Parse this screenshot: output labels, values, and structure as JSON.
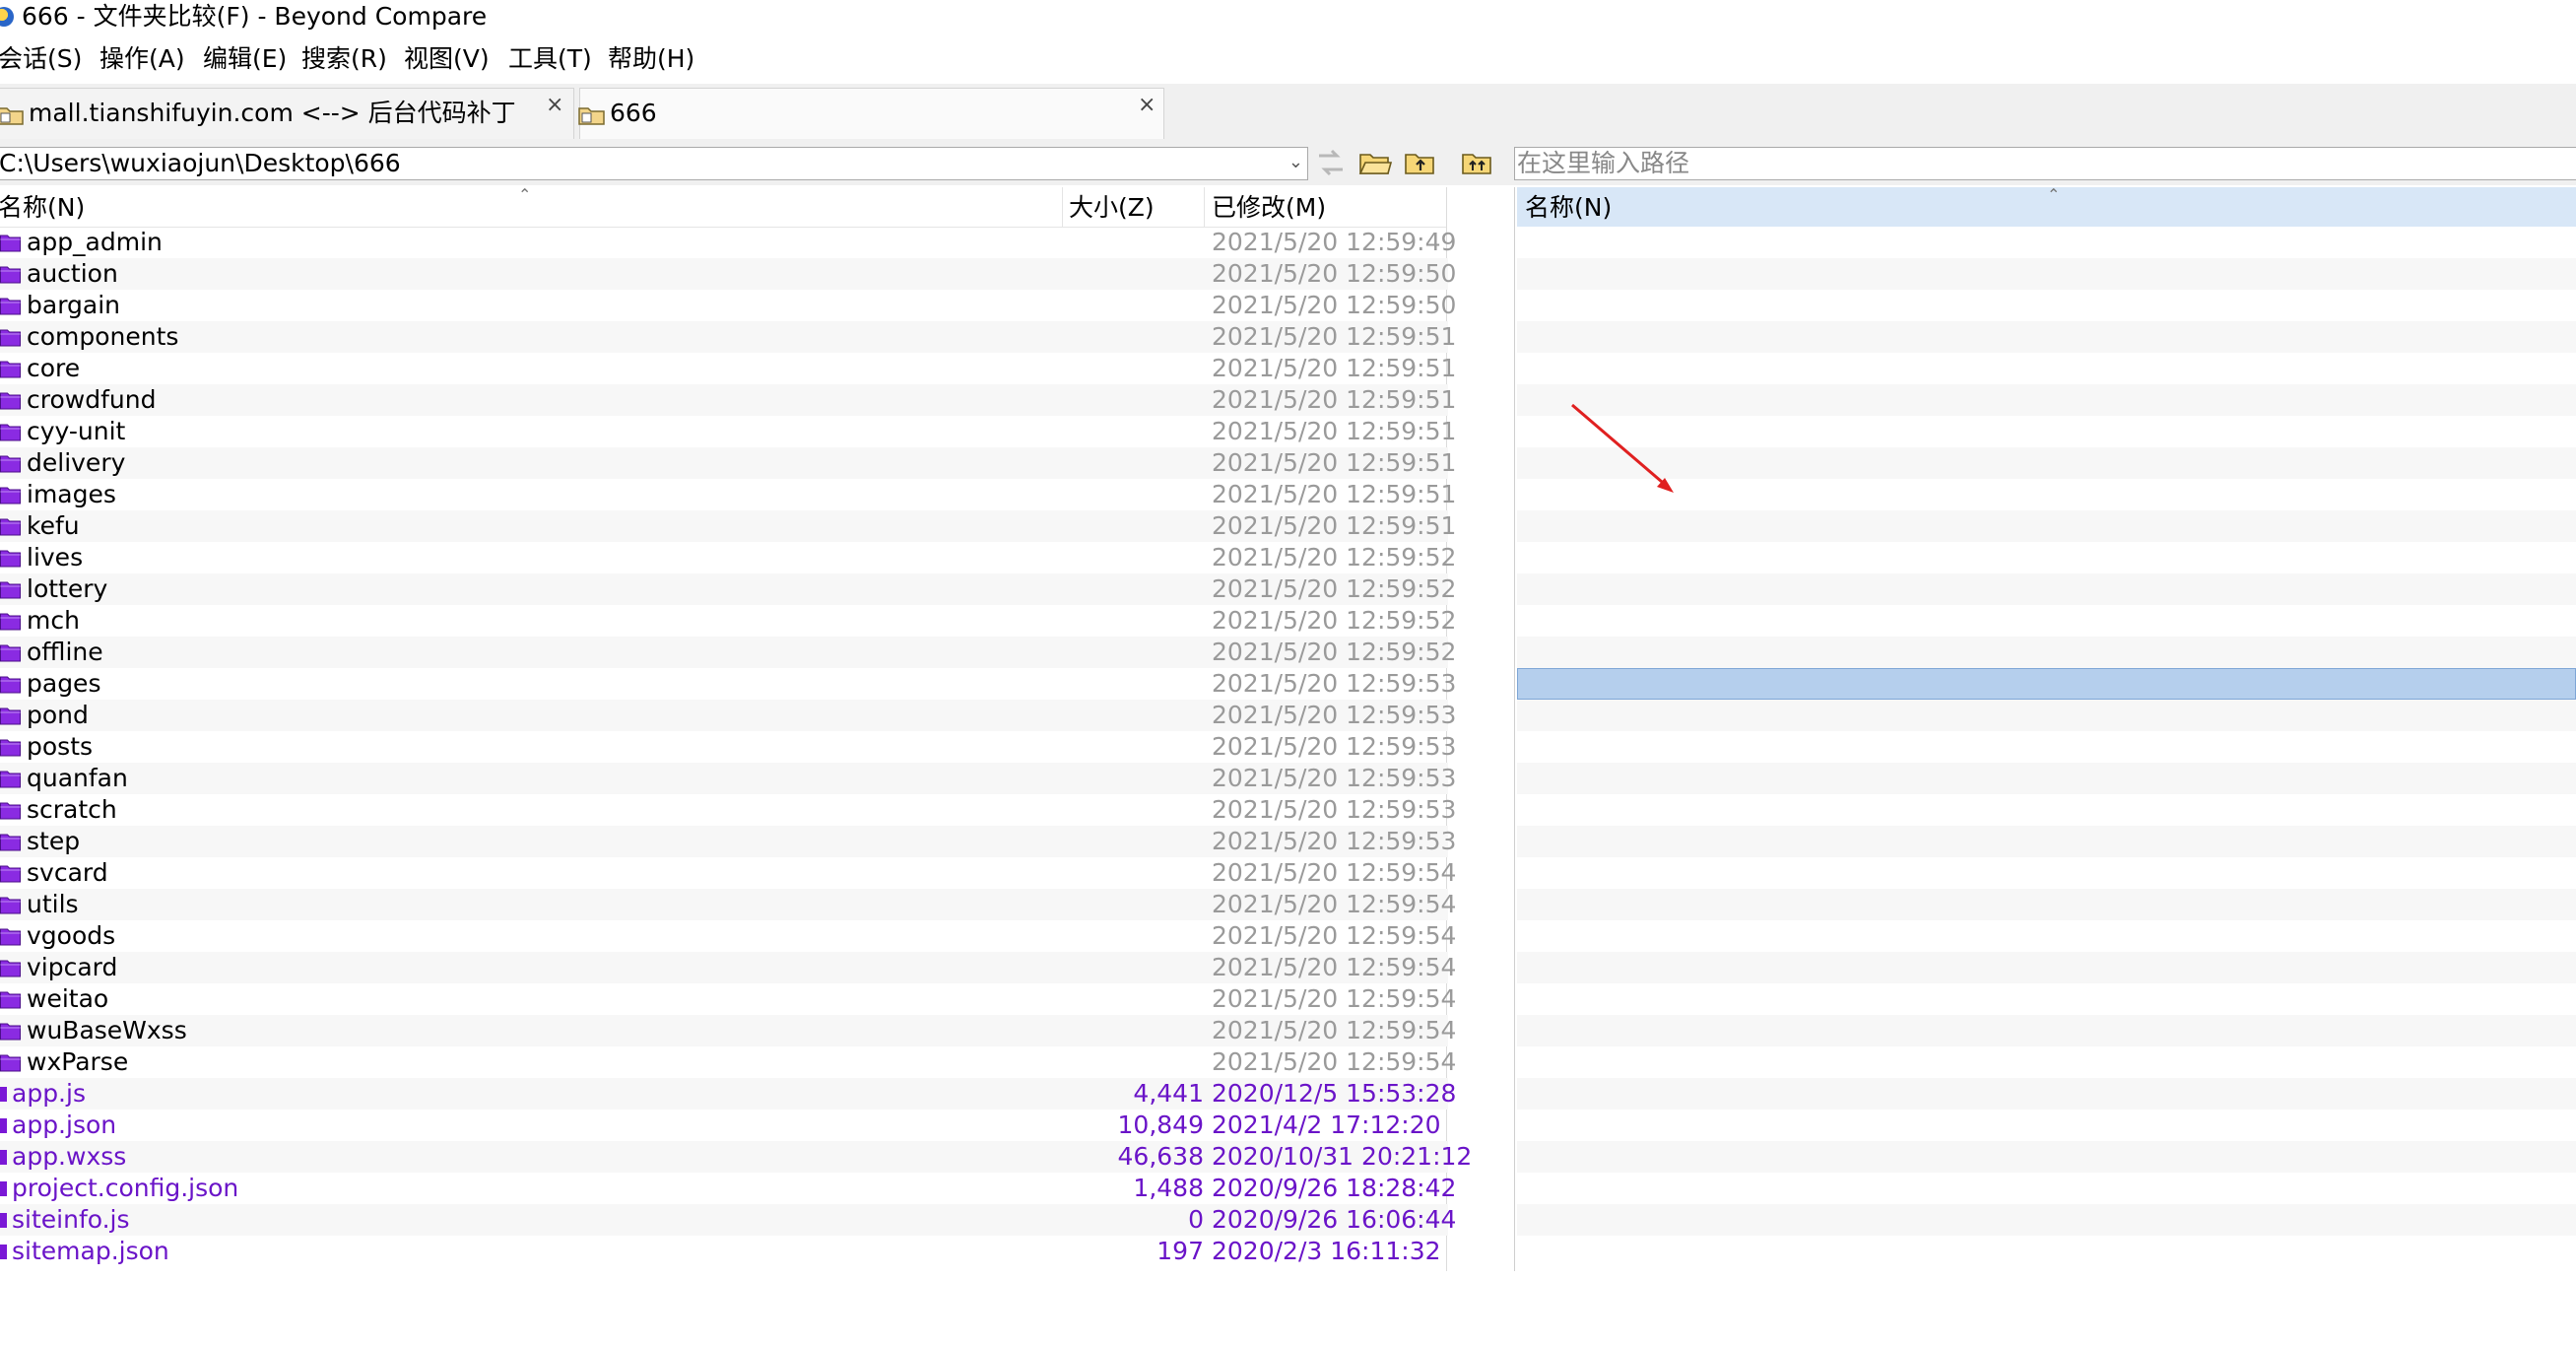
{
  "title_bar": {
    "title": "666 - 文件夹比较(F) - Beyond Compare"
  },
  "menu": {
    "items": [
      "会话(S)",
      "操作(A)",
      "编辑(E)",
      "搜索(R)",
      "视图(V)",
      "工具(T)",
      "帮助(H)"
    ]
  },
  "tabs": [
    {
      "label": "mall.tianshifuyin.com <--> 后台代码补丁",
      "close": "×"
    },
    {
      "label": "666",
      "close": "×"
    }
  ],
  "path_bar": {
    "left_path": "C:\\Users\\wuxiaojun\\Desktop\\666",
    "right_placeholder": "在这里输入路径"
  },
  "left_columns": {
    "name": "名称(N)",
    "size": "大小(Z)",
    "modified": "已修改(M)"
  },
  "right_columns": {
    "name": "名称(N)"
  },
  "folders": [
    {
      "name": "app_admin",
      "modified": "2021/5/20 12:59:49"
    },
    {
      "name": "auction",
      "modified": "2021/5/20 12:59:50"
    },
    {
      "name": "bargain",
      "modified": "2021/5/20 12:59:50"
    },
    {
      "name": "components",
      "modified": "2021/5/20 12:59:51"
    },
    {
      "name": "core",
      "modified": "2021/5/20 12:59:51"
    },
    {
      "name": "crowdfund",
      "modified": "2021/5/20 12:59:51"
    },
    {
      "name": "cyy-unit",
      "modified": "2021/5/20 12:59:51"
    },
    {
      "name": "delivery",
      "modified": "2021/5/20 12:59:51"
    },
    {
      "name": "images",
      "modified": "2021/5/20 12:59:51"
    },
    {
      "name": "kefu",
      "modified": "2021/5/20 12:59:51"
    },
    {
      "name": "lives",
      "modified": "2021/5/20 12:59:52"
    },
    {
      "name": "lottery",
      "modified": "2021/5/20 12:59:52"
    },
    {
      "name": "mch",
      "modified": "2021/5/20 12:59:52"
    },
    {
      "name": "offline",
      "modified": "2021/5/20 12:59:52"
    },
    {
      "name": "pages",
      "modified": "2021/5/20 12:59:53"
    },
    {
      "name": "pond",
      "modified": "2021/5/20 12:59:53"
    },
    {
      "name": "posts",
      "modified": "2021/5/20 12:59:53"
    },
    {
      "name": "quanfan",
      "modified": "2021/5/20 12:59:53"
    },
    {
      "name": "scratch",
      "modified": "2021/5/20 12:59:53"
    },
    {
      "name": "step",
      "modified": "2021/5/20 12:59:53"
    },
    {
      "name": "svcard",
      "modified": "2021/5/20 12:59:54"
    },
    {
      "name": "utils",
      "modified": "2021/5/20 12:59:54"
    },
    {
      "name": "vgoods",
      "modified": "2021/5/20 12:59:54"
    },
    {
      "name": "vipcard",
      "modified": "2021/5/20 12:59:54"
    },
    {
      "name": "weitao",
      "modified": "2021/5/20 12:59:54"
    },
    {
      "name": "wuBaseWxss",
      "modified": "2021/5/20 12:59:54"
    },
    {
      "name": "wxParse",
      "modified": "2021/5/20 12:59:54"
    }
  ],
  "files": [
    {
      "name": "app.js",
      "size": "4,441",
      "modified": "2020/12/5 15:53:28"
    },
    {
      "name": "app.json",
      "size": "10,849",
      "modified": "2021/4/2 17:12:20"
    },
    {
      "name": "app.wxss",
      "size": "46,638",
      "modified": "2020/10/31 20:21:12"
    },
    {
      "name": "project.config.json",
      "size": "1,488",
      "modified": "2020/9/26 18:28:42"
    },
    {
      "name": "siteinfo.js",
      "size": "0",
      "modified": "2020/9/26 16:06:44"
    },
    {
      "name": "sitemap.json",
      "size": "197",
      "modified": "2020/2/3 16:11:32"
    }
  ],
  "right_selected_row": 14,
  "colors": {
    "file_text": "#6a14c8",
    "folder_icon": "#8a2be2",
    "date_gray": "#9a9a9a",
    "selection": "#b5cfed",
    "header_active": "#d8e7f7",
    "annotation_arrow": "#e02020"
  }
}
